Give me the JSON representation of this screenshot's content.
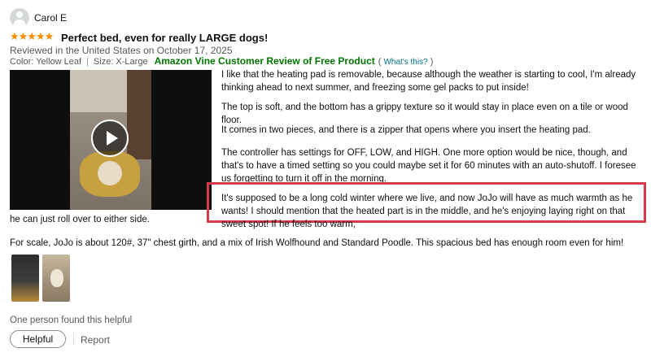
{
  "review": {
    "author": "Carol E",
    "stars": "★★★★★",
    "rating": 5,
    "title": "Perfect bed, even for really LARGE dogs!",
    "reviewed_in": "Reviewed in the United States on October 17, 2025",
    "color_label": "Color: Yellow Leaf",
    "size_label": "Size: X-Large",
    "vine_label": "Amazon Vine Customer Review of Free Product",
    "paren_open": "(",
    "whats_this": "What's this?",
    "paren_close": ")",
    "paragraphs": [
      "I like that the heating pad is removable, because although the weather is starting to cool, I'm already thinking ahead to next summer, and freezing some gel packs to put inside!",
      "The top is soft, and the bottom has a grippy texture so it would stay in place even on a tile or wood floor.",
      "It comes in two pieces, and there is a zipper that opens where you insert the heating pad.",
      "The controller has settings for OFF, LOW, and HIGH. One more option would be nice, though, and that's to have a timed setting so you could maybe set it for 60 minutes with an auto-shutoff. I foresee us forgetting to turn it off in the morning."
    ],
    "highlighted": "It's supposed to be a long cold winter where we live, and now JoJo will have as much warmth as he wants! I should mention that the heated part is in the middle, and he's enjoying laying right on that sweet spot! If he feels too warm,",
    "continuation": "he can just roll over to either side.",
    "scale_text": "For scale, JoJo is about 120#, 37\" chest girth, and a mix of Irish Wolfhound and Standard Poodle. This spacious bed has enough room even for him!",
    "helpful_count": "One person found this helpful",
    "helpful_button": "Helpful",
    "report_link": "Report"
  },
  "colors": {
    "star": "#ff8a00",
    "vine": "#007600",
    "link": "#007185",
    "highlight_border": "#d83a4a"
  }
}
